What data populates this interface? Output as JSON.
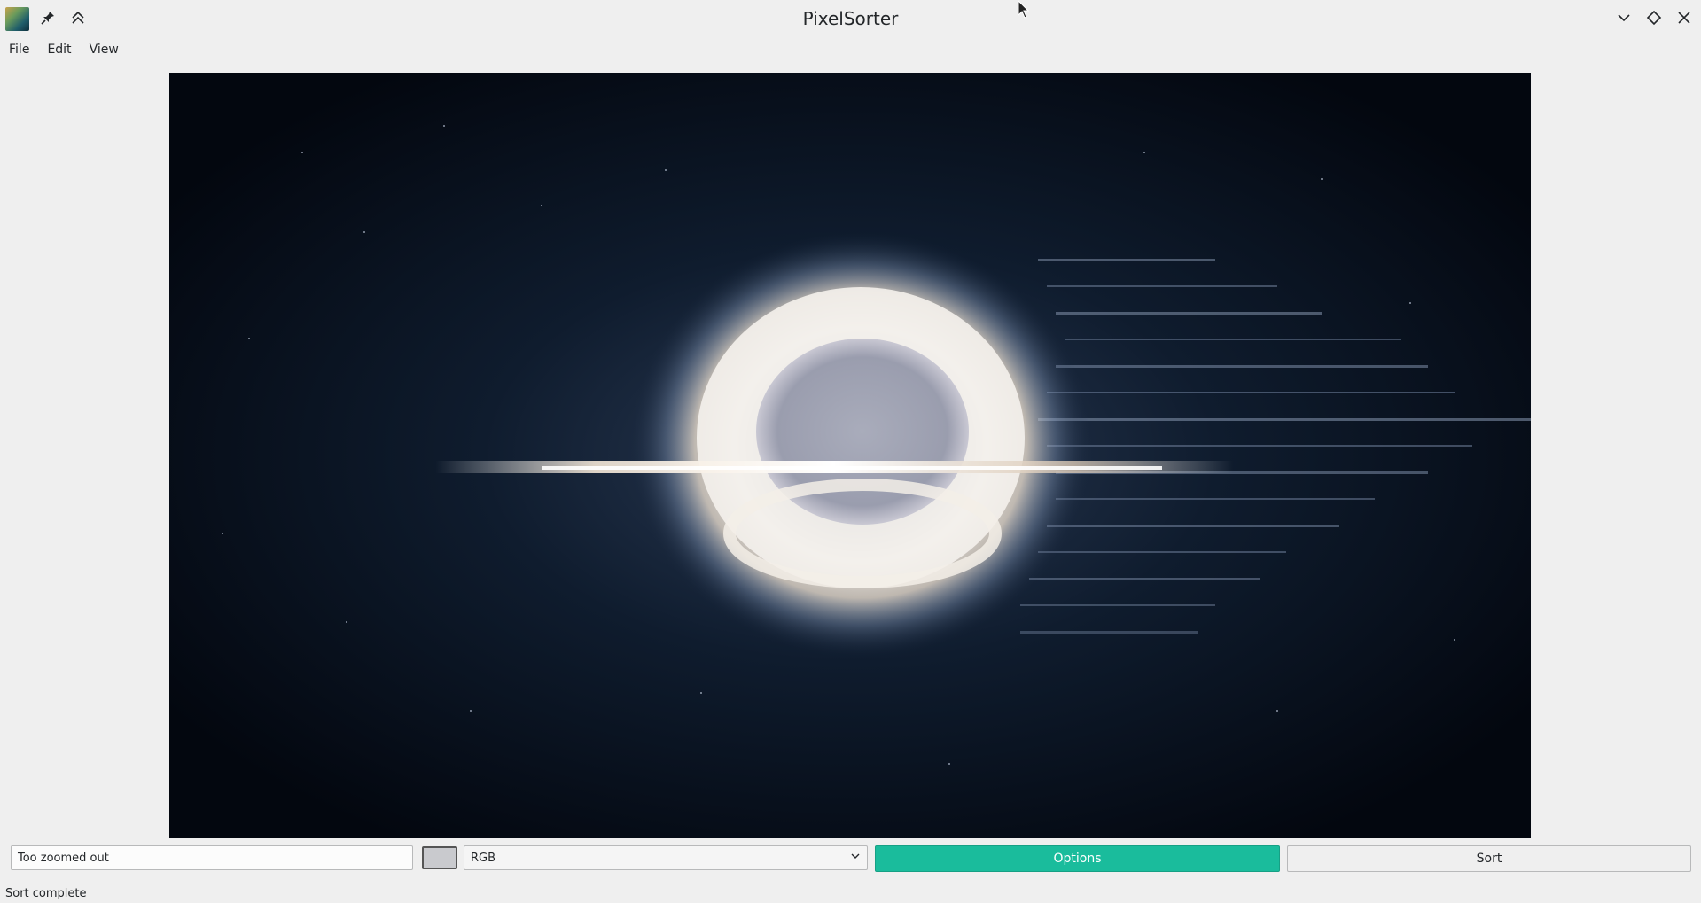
{
  "window": {
    "title": "PixelSorter"
  },
  "titlebar": {
    "app_icon": "pixelsorter-app-icon",
    "left_buttons": [
      "pin-icon",
      "keep-above-icon"
    ],
    "right_buttons": [
      "minimize-icon",
      "maximize-icon",
      "close-icon"
    ]
  },
  "menu": {
    "items": [
      {
        "label": "File"
      },
      {
        "label": "Edit"
      },
      {
        "label": "View"
      }
    ]
  },
  "canvas": {
    "description_icon": "sorted-image-black-hole",
    "colors": {
      "background": "#050a13",
      "glow": "#f3eee8",
      "accent": "#c6a98a"
    }
  },
  "controls": {
    "threshold_value": "Too zoomed out",
    "swatch_color": "#c9cace",
    "mode_select": {
      "selected": "RGB"
    },
    "options_label": "Options",
    "sort_label": "Sort",
    "accent_color": "#1abc9c"
  },
  "status": {
    "text": "Sort complete"
  }
}
